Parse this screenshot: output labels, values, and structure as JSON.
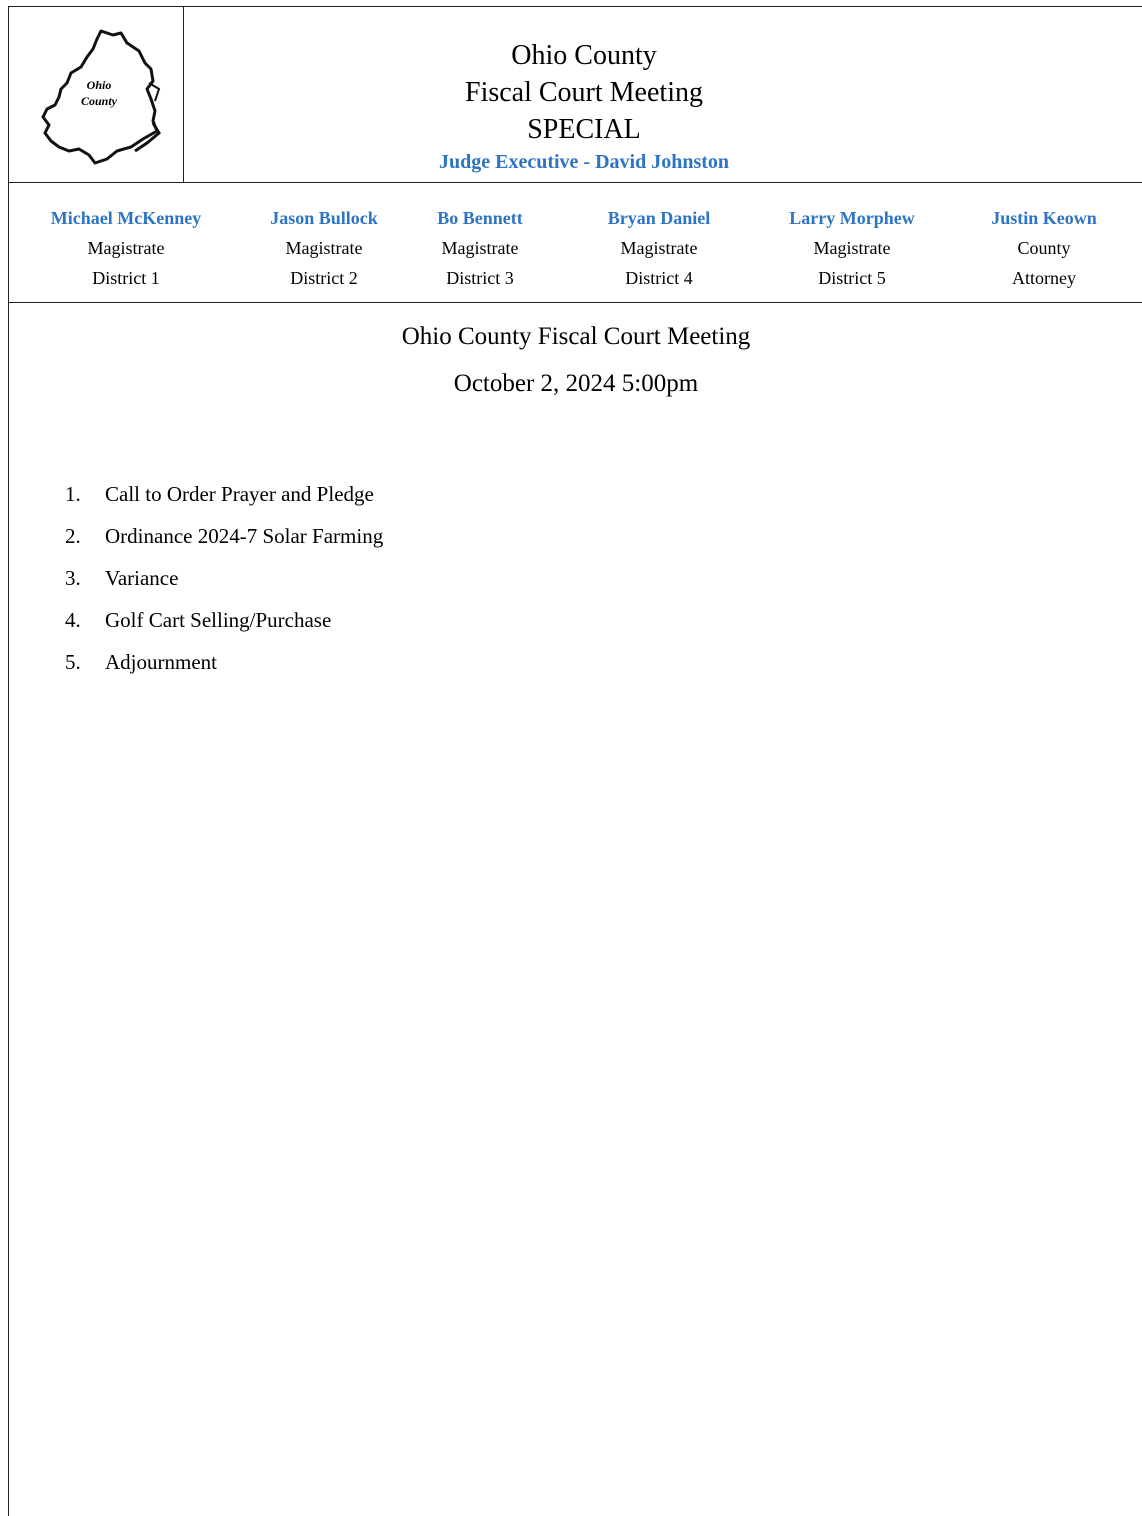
{
  "header": {
    "logo_text_line1": "Ohio",
    "logo_text_line2": "County",
    "title_line1": "Ohio County",
    "title_line2": "Fiscal Court Meeting",
    "title_line3": "SPECIAL",
    "judge_line": "Judge Executive - David Johnston",
    "accent_color": "#2e74c4"
  },
  "members": [
    {
      "name": "Michael McKenney",
      "role": "Magistrate",
      "detail": "District 1"
    },
    {
      "name": "Jason Bullock",
      "role": "Magistrate",
      "detail": "District 2"
    },
    {
      "name": "Bo Bennett",
      "role": "Magistrate",
      "detail": "District 3"
    },
    {
      "name": "Bryan Daniel",
      "role": "Magistrate",
      "detail": "District 4"
    },
    {
      "name": "Larry Morphew",
      "role": "Magistrate",
      "detail": "District 5"
    },
    {
      "name": "Justin Keown",
      "role": "County",
      "detail": "Attorney"
    }
  ],
  "meeting": {
    "title": "Ohio County Fiscal Court Meeting",
    "datetime": "October 2, 2024 5:00pm"
  },
  "agenda": [
    {
      "num": "1.",
      "text": "Call to Order Prayer and Pledge"
    },
    {
      "num": "2.",
      "text": "Ordinance 2024-7 Solar Farming"
    },
    {
      "num": "3.",
      "text": "Variance"
    },
    {
      "num": "4.",
      "text": "Golf Cart Selling/Purchase"
    },
    {
      "num": "5.",
      "text": "Adjournment"
    }
  ]
}
